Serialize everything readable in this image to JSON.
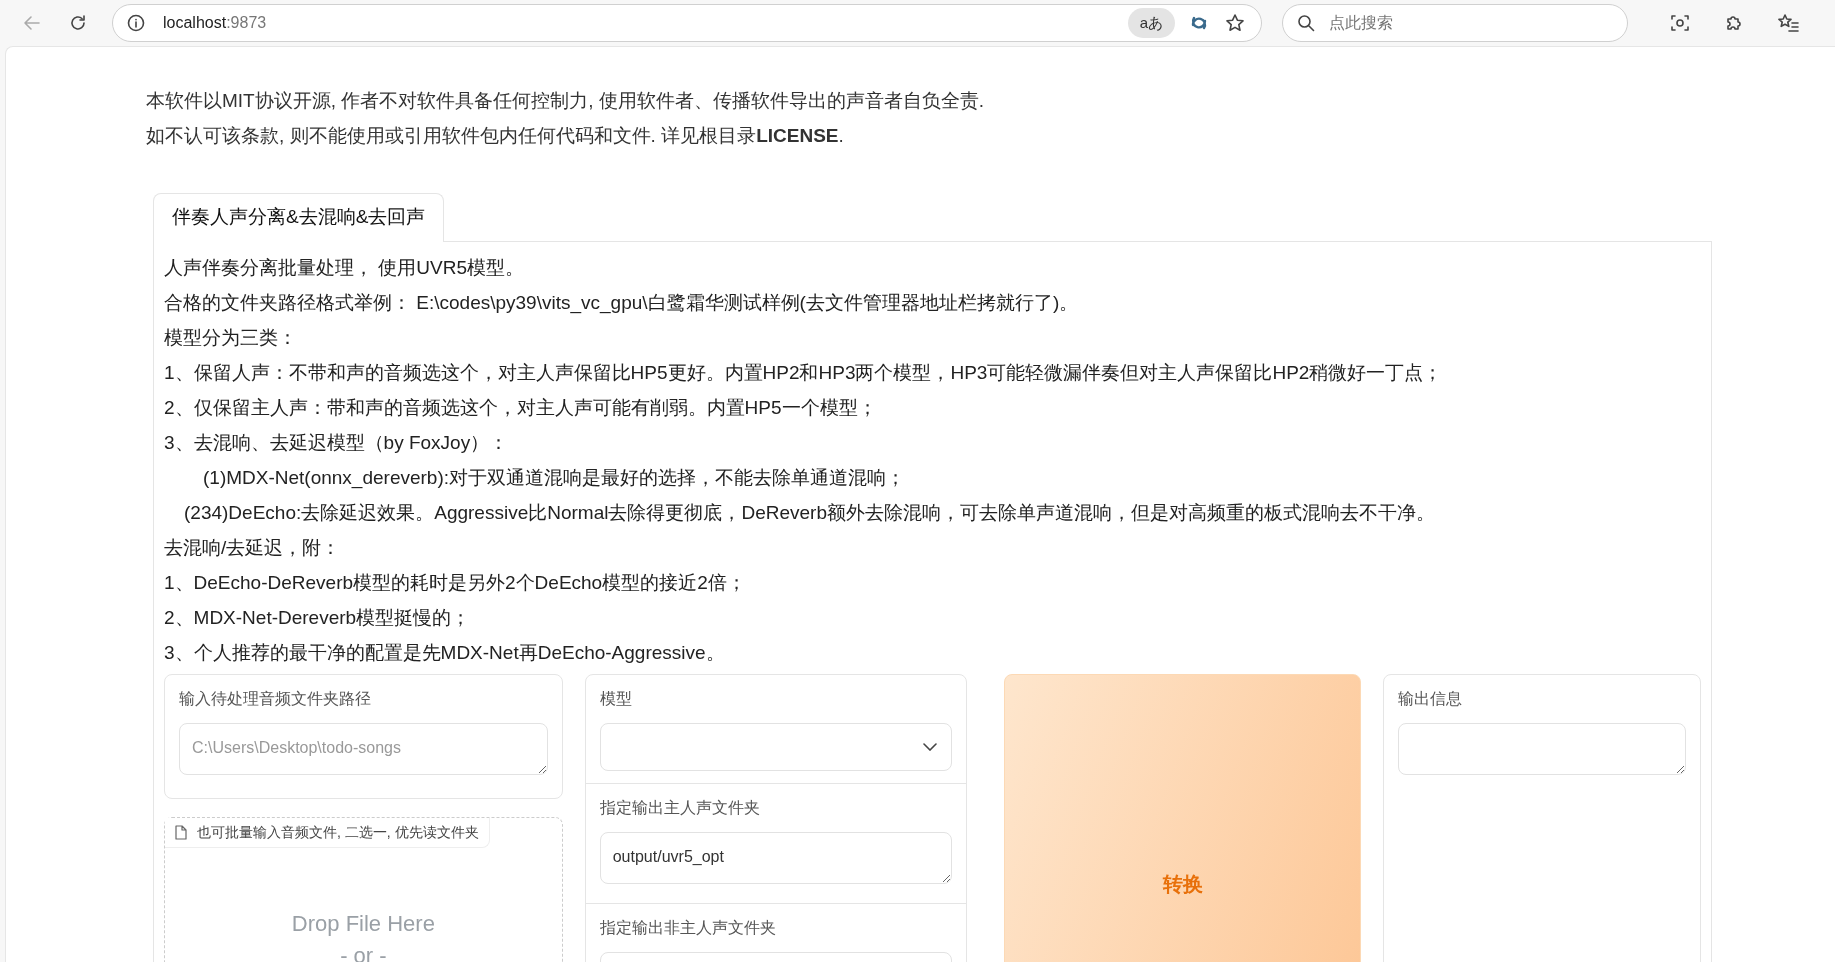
{
  "browser": {
    "address_host": "localhost",
    "address_port": ":9873",
    "translate_label": "aあ",
    "search_placeholder": "点此搜索"
  },
  "notice": [
    "本软件以MIT协议开源, 作者不对软件具备任何控制力, 使用软件者、传播软件导出的声音者自负全责.",
    "如不认可该条款, 则不能使用或引用软件包内任何代码和文件. 详见根目录**LICENSE**."
  ],
  "tabs": [
    {
      "label": "伴奏人声分离&去混响&去回声",
      "selected": true
    }
  ],
  "description": [
    {
      "kind": "plain",
      "text": "人声伴奏分离批量处理， 使用UVR5模型。"
    },
    {
      "kind": "plain",
      "text": "合格的文件夹路径格式举例： E:\\codes\\py39\\vits_vc_gpu\\白鹭霜华测试样例(去文件管理器地址栏拷就行了)。"
    },
    {
      "kind": "plain",
      "text": "模型分为三类："
    },
    {
      "kind": "plain",
      "text": "1、保留人声：不带和声的音频选这个，对主人声保留比HP5更好。内置HP2和HP3两个模型，HP3可能轻微漏伴奏但对主人声保留比HP2稍微好一丁点；"
    },
    {
      "kind": "plain",
      "text": "2、仅保留主人声：带和声的音频选这个，对主人声可能有削弱。内置HP5一个模型；"
    },
    {
      "kind": "plain",
      "text": "3、去混响、去延迟模型（by FoxJoy）："
    },
    {
      "kind": "deep",
      "text": "(1)MDX-Net(onnx_dereverb):对于双通道混响是最好的选择，不能去除单通道混响；"
    },
    {
      "kind": "shallow",
      "text": "(234)DeEcho:去除延迟效果。Aggressive比Normal去除得更彻底，DeReverb额外去除混响，可去除单声道混响，但是对高频重的板式混响去不干净。"
    },
    {
      "kind": "plain",
      "text": "去混响/去延迟，附："
    },
    {
      "kind": "plain",
      "text": "1、DeEcho-DeReverb模型的耗时是另外2个DeEcho模型的接近2倍；"
    },
    {
      "kind": "plain",
      "text": "2、MDX-Net-Dereverb模型挺慢的；"
    },
    {
      "kind": "plain",
      "text": "3、个人推荐的最干净的配置是先MDX-Net再DeEcho-Aggressive。"
    }
  ],
  "folder_input": {
    "label": "输入待处理音频文件夹路径",
    "placeholder": "C:\\Users\\Desktop\\todo-songs"
  },
  "upload": {
    "label": "也可批量输入音频文件, 二选一, 优先读文件夹",
    "drop_text": "Drop File Here",
    "or_text": "- or -"
  },
  "model_select": {
    "label": "模型"
  },
  "vocal_dir": {
    "label": "指定输出主人声文件夹",
    "value": "output/uvr5_opt"
  },
  "other_dir": {
    "label": "指定输出非主人声文件夹"
  },
  "convert_button": "转换",
  "output_info": {
    "label": "输出信息"
  }
}
